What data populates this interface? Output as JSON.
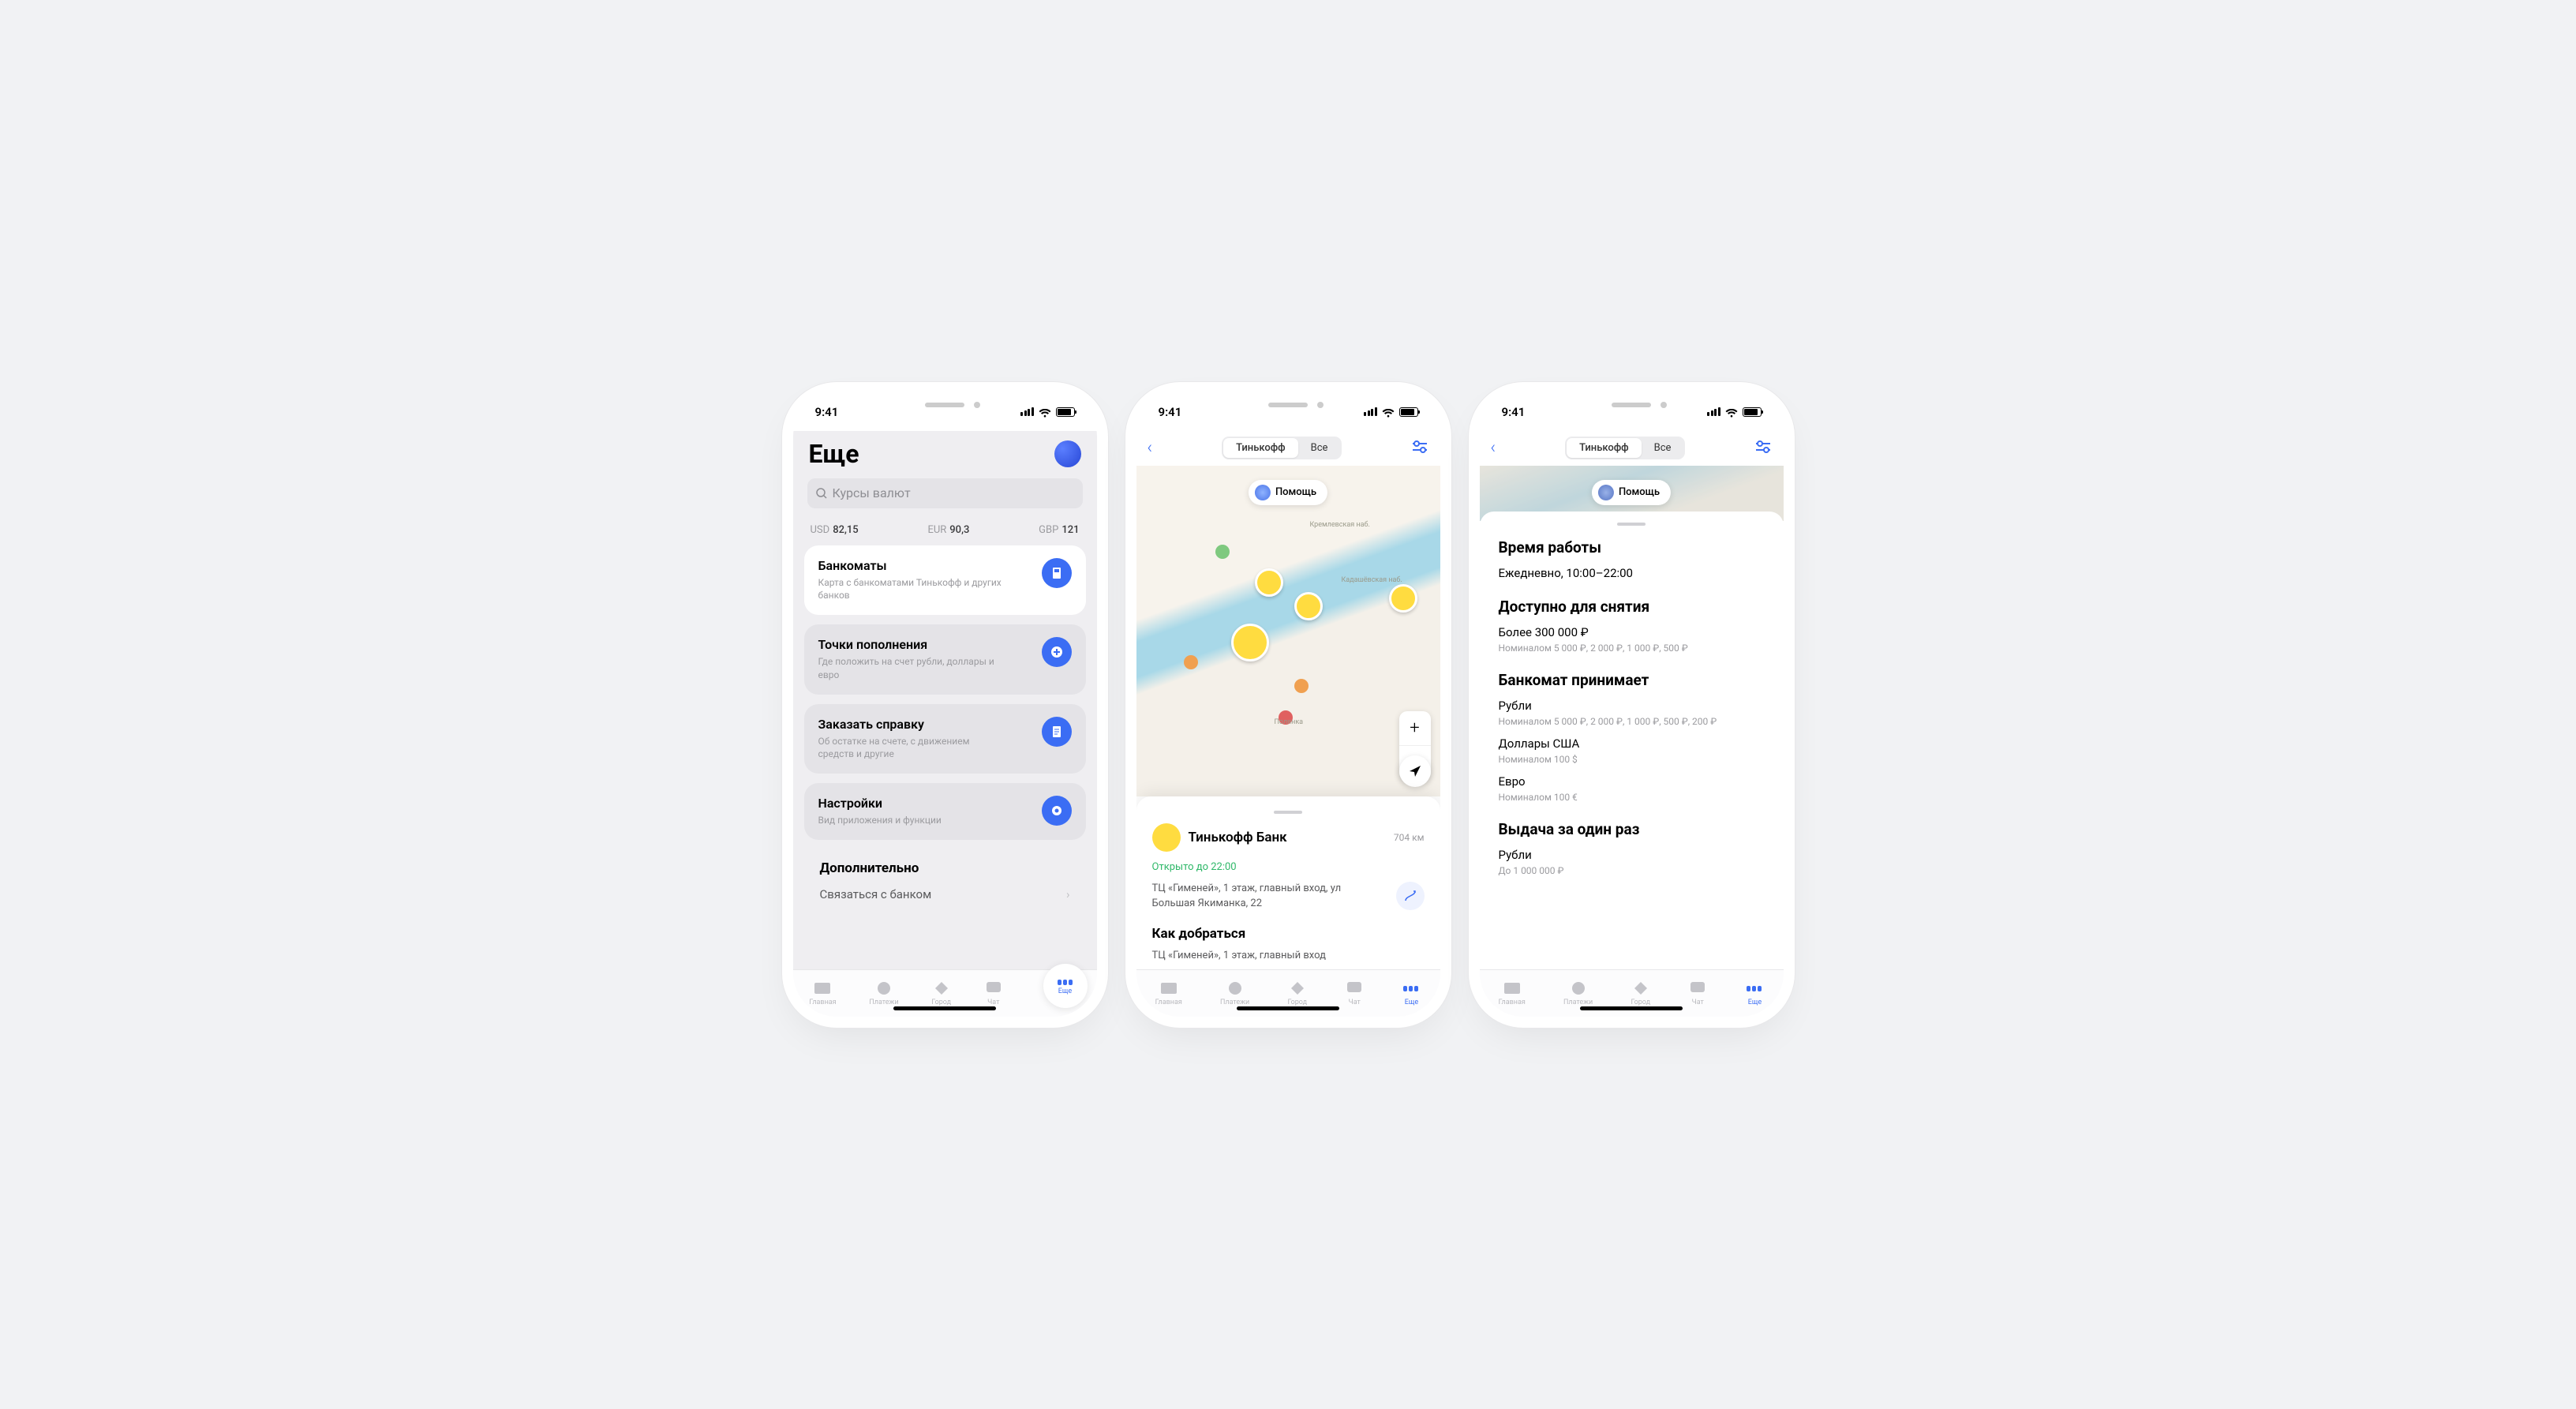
{
  "status": {
    "time": "9:41"
  },
  "tabbar": {
    "items": [
      {
        "label": "Главная"
      },
      {
        "label": "Платежи"
      },
      {
        "label": "Город"
      },
      {
        "label": "Чат"
      },
      {
        "label": "Еще"
      }
    ]
  },
  "screen1": {
    "title": "Еще",
    "search_placeholder": "Курсы валют",
    "rates": [
      {
        "cur": "USD",
        "val": "82,15"
      },
      {
        "cur": "EUR",
        "val": "90,3"
      },
      {
        "cur": "GBP",
        "val": "121"
      }
    ],
    "cards": [
      {
        "title": "Банкоматы",
        "sub": "Карта с банкоматами Тинькофф и других банков"
      },
      {
        "title": "Точки пополнения",
        "sub": "Где положить на счет рубли, доллары и евро"
      },
      {
        "title": "Заказать справку",
        "sub": "Об остатке на счете, с движением средств и другие"
      },
      {
        "title": "Настройки",
        "sub": "Вид приложения и функции"
      }
    ],
    "extra_heading": "Дополнительно",
    "extra_item": "Связаться с банком"
  },
  "screen2": {
    "seg": [
      "Тинькофф",
      "Все"
    ],
    "help": "Помощь",
    "bank": "Тинькофф Банк",
    "distance": "704 км",
    "open": "Открыто до 22:00",
    "address": "ТЦ «Гименей», 1 этаж, главный вход, ул Большая Якиманка, 22",
    "how_heading": "Как добраться",
    "how_text": "ТЦ «Гименей», 1 этаж, главный вход"
  },
  "screen3": {
    "hours_h": "Время работы",
    "hours_v": "Ежедневно, 10:00–22:00",
    "withdraw_h": "Доступно для снятия",
    "withdraw_v": "Более 300 000 ₽",
    "withdraw_m": "Номиналом 5 000 ₽, 2 000 ₽, 1 000 ₽, 500 ₽",
    "accepts_h": "Банкомат принимает",
    "accepts": [
      {
        "v": "Рубли",
        "m": "Номиналом 5 000 ₽, 2 000 ₽, 1 000 ₽, 500 ₽, 200 ₽"
      },
      {
        "v": "Доллары США",
        "m": "Номиналом 100 $"
      },
      {
        "v": "Евро",
        "m": "Номиналом 100 €"
      }
    ],
    "once_h": "Выдача за один раз",
    "once_v": "Рубли",
    "once_m": "До 1 000 000 ₽"
  }
}
